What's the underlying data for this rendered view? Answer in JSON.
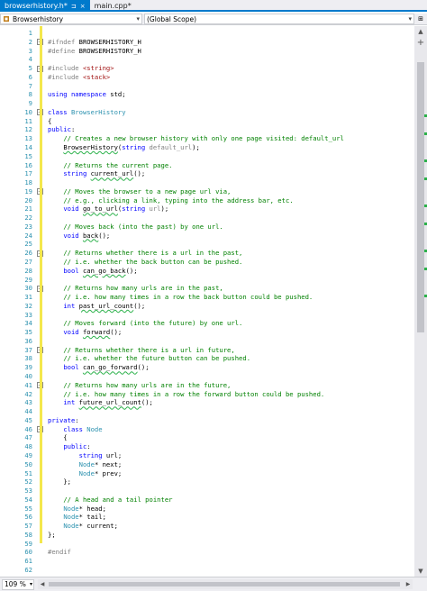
{
  "tabs": [
    {
      "label": "browserhistory.h*",
      "active": true,
      "pin": "⊐",
      "close": "×"
    },
    {
      "label": "main.cpp*",
      "active": false
    }
  ],
  "nav": {
    "scope_left": "Browserhistory",
    "scope_right": "(Global Scope)"
  },
  "status": {
    "zoom": "109 %"
  },
  "colors": {
    "accent": "#007acc",
    "change_bar": "#f4e84c",
    "line_number": "#2b91af"
  },
  "code": [
    {
      "n": "1",
      "t": [
        [
          ""
        ]
      ]
    },
    {
      "n": "2",
      "t": [
        [
          "pp",
          "#ifndef "
        ],
        [
          "",
          "BROWSERHISTORY_H"
        ]
      ],
      "fold": "−"
    },
    {
      "n": "3",
      "t": [
        [
          "pp",
          "#define "
        ],
        [
          "",
          "BROWSERHISTORY_H"
        ]
      ]
    },
    {
      "n": "4",
      "t": [
        [
          ""
        ]
      ]
    },
    {
      "n": "5",
      "t": [
        [
          "pp",
          "#include "
        ],
        [
          "str",
          "<string>"
        ]
      ],
      "fold": "−"
    },
    {
      "n": "6",
      "t": [
        [
          "pp",
          "#include "
        ],
        [
          "str",
          "<stack>"
        ]
      ]
    },
    {
      "n": "7",
      "t": [
        [
          ""
        ]
      ]
    },
    {
      "n": "8",
      "t": [
        [
          "kw",
          "using namespace "
        ],
        [
          "",
          "std;"
        ]
      ]
    },
    {
      "n": "9",
      "t": [
        [
          ""
        ]
      ]
    },
    {
      "n": "10",
      "t": [
        [
          "kw",
          "class "
        ],
        [
          "type",
          "BrowserHistory"
        ]
      ],
      "fold": "−"
    },
    {
      "n": "11",
      "t": [
        [
          "",
          "{"
        ]
      ]
    },
    {
      "n": "12",
      "t": [
        [
          "kw",
          "public"
        ],
        [
          "",
          ":"
        ]
      ]
    },
    {
      "n": "13",
      "t": [
        [
          "",
          "    "
        ],
        [
          "cmt",
          "// Creates a new browser history with only one page visited: default_url"
        ]
      ]
    },
    {
      "n": "14",
      "t": [
        [
          "",
          "    "
        ],
        [
          "fn",
          "BrowserHistory"
        ],
        [
          "",
          "("
        ],
        [
          "kw",
          "string "
        ],
        [
          "param",
          "default_url"
        ],
        [
          "",
          ");"
        ]
      ]
    },
    {
      "n": "15",
      "t": [
        [
          ""
        ]
      ]
    },
    {
      "n": "16",
      "t": [
        [
          "",
          "    "
        ],
        [
          "cmt",
          "// Returns the current page."
        ]
      ]
    },
    {
      "n": "17",
      "t": [
        [
          "",
          "    "
        ],
        [
          "kw",
          "string "
        ],
        [
          "fn",
          "current_url"
        ],
        [
          "",
          "();"
        ]
      ]
    },
    {
      "n": "18",
      "t": [
        [
          ""
        ]
      ]
    },
    {
      "n": "19",
      "t": [
        [
          "",
          "    "
        ],
        [
          "cmt",
          "// Moves the browser to a new page url via,"
        ]
      ],
      "fold": "−"
    },
    {
      "n": "20",
      "t": [
        [
          "",
          "    "
        ],
        [
          "cmt",
          "// e.g., clicking a link, typing into the address bar, etc."
        ]
      ]
    },
    {
      "n": "21",
      "t": [
        [
          "",
          "    "
        ],
        [
          "kw",
          "void "
        ],
        [
          "fn",
          "go_to_url"
        ],
        [
          "",
          "("
        ],
        [
          "kw",
          "string "
        ],
        [
          "param",
          "url"
        ],
        [
          "",
          ");"
        ]
      ]
    },
    {
      "n": "22",
      "t": [
        [
          ""
        ]
      ]
    },
    {
      "n": "23",
      "t": [
        [
          "",
          "    "
        ],
        [
          "cmt",
          "// Moves back (into the past) by one url."
        ]
      ]
    },
    {
      "n": "24",
      "t": [
        [
          "",
          "    "
        ],
        [
          "kw",
          "void "
        ],
        [
          "fn",
          "back"
        ],
        [
          "",
          "();"
        ]
      ]
    },
    {
      "n": "25",
      "t": [
        [
          ""
        ]
      ]
    },
    {
      "n": "26",
      "t": [
        [
          "",
          "    "
        ],
        [
          "cmt",
          "// Returns whether there is a url in the past,"
        ]
      ],
      "fold": "−"
    },
    {
      "n": "27",
      "t": [
        [
          "",
          "    "
        ],
        [
          "cmt",
          "// i.e. whether the back button can be pushed."
        ]
      ]
    },
    {
      "n": "28",
      "t": [
        [
          "",
          "    "
        ],
        [
          "kw",
          "bool "
        ],
        [
          "fn",
          "can_go_back"
        ],
        [
          "",
          "();"
        ]
      ]
    },
    {
      "n": "29",
      "t": [
        [
          ""
        ]
      ]
    },
    {
      "n": "30",
      "t": [
        [
          "",
          "    "
        ],
        [
          "cmt",
          "// Returns how many urls are in the past,"
        ]
      ],
      "fold": "−"
    },
    {
      "n": "31",
      "t": [
        [
          "",
          "    "
        ],
        [
          "cmt",
          "// i.e. how many times in a row the back button could be pushed."
        ]
      ]
    },
    {
      "n": "32",
      "t": [
        [
          "",
          "    "
        ],
        [
          "kw",
          "int "
        ],
        [
          "fn",
          "past_url_count"
        ],
        [
          "",
          "();"
        ]
      ]
    },
    {
      "n": "33",
      "t": [
        [
          ""
        ]
      ]
    },
    {
      "n": "34",
      "t": [
        [
          "",
          "    "
        ],
        [
          "cmt",
          "// Moves forward (into the future) by one url."
        ]
      ]
    },
    {
      "n": "35",
      "t": [
        [
          "",
          "    "
        ],
        [
          "kw",
          "void "
        ],
        [
          "fn",
          "forward"
        ],
        [
          "",
          "();"
        ]
      ]
    },
    {
      "n": "36",
      "t": [
        [
          ""
        ]
      ]
    },
    {
      "n": "37",
      "t": [
        [
          "",
          "    "
        ],
        [
          "cmt",
          "// Returns whether there is a url in future,"
        ]
      ],
      "fold": "−"
    },
    {
      "n": "38",
      "t": [
        [
          "",
          "    "
        ],
        [
          "cmt",
          "// i.e. whether the future button can be pushed."
        ]
      ]
    },
    {
      "n": "39",
      "t": [
        [
          "",
          "    "
        ],
        [
          "kw",
          "bool "
        ],
        [
          "fn",
          "can_go_forward"
        ],
        [
          "",
          "();"
        ]
      ]
    },
    {
      "n": "40",
      "t": [
        [
          ""
        ]
      ]
    },
    {
      "n": "41",
      "t": [
        [
          "",
          "    "
        ],
        [
          "cmt",
          "// Returns how many urls are in the future,"
        ]
      ],
      "fold": "−"
    },
    {
      "n": "42",
      "t": [
        [
          "",
          "    "
        ],
        [
          "cmt",
          "// i.e. how many times in a row the forward button could be pushed."
        ]
      ]
    },
    {
      "n": "43",
      "t": [
        [
          "",
          "    "
        ],
        [
          "kw",
          "int "
        ],
        [
          "fn",
          "future_url_count"
        ],
        [
          "",
          "();"
        ]
      ]
    },
    {
      "n": "44",
      "t": [
        [
          ""
        ]
      ]
    },
    {
      "n": "45",
      "t": [
        [
          "kw",
          "private"
        ],
        [
          "",
          ":"
        ]
      ]
    },
    {
      "n": "46",
      "t": [
        [
          "",
          "    "
        ],
        [
          "kw",
          "class "
        ],
        [
          "type",
          "Node"
        ]
      ],
      "fold": "−"
    },
    {
      "n": "47",
      "t": [
        [
          "",
          "    {"
        ]
      ]
    },
    {
      "n": "48",
      "t": [
        [
          "",
          "    "
        ],
        [
          "kw",
          "public"
        ],
        [
          "",
          ":"
        ]
      ]
    },
    {
      "n": "49",
      "t": [
        [
          "",
          "        "
        ],
        [
          "kw",
          "string "
        ],
        [
          "",
          "url;"
        ]
      ]
    },
    {
      "n": "50",
      "t": [
        [
          "",
          "        "
        ],
        [
          "type",
          "Node"
        ],
        [
          "",
          "* next;"
        ]
      ]
    },
    {
      "n": "51",
      "t": [
        [
          "",
          "        "
        ],
        [
          "type",
          "Node"
        ],
        [
          "",
          "* prev;"
        ]
      ]
    },
    {
      "n": "52",
      "t": [
        [
          "",
          "    };"
        ]
      ]
    },
    {
      "n": "53",
      "t": [
        [
          ""
        ]
      ]
    },
    {
      "n": "54",
      "t": [
        [
          "",
          "    "
        ],
        [
          "cmt",
          "// A head and a tail pointer"
        ]
      ]
    },
    {
      "n": "55",
      "t": [
        [
          "",
          "    "
        ],
        [
          "type",
          "Node"
        ],
        [
          "",
          "* head;"
        ]
      ]
    },
    {
      "n": "56",
      "t": [
        [
          "",
          "    "
        ],
        [
          "type",
          "Node"
        ],
        [
          "",
          "* tail;"
        ]
      ]
    },
    {
      "n": "57",
      "t": [
        [
          "",
          "    "
        ],
        [
          "type",
          "Node"
        ],
        [
          "",
          "* current;"
        ]
      ]
    },
    {
      "n": "58",
      "t": [
        [
          "",
          "};"
        ]
      ]
    },
    {
      "n": "59",
      "t": [
        [
          ""
        ]
      ]
    },
    {
      "n": "60",
      "t": [
        [
          "pp",
          "#endif"
        ]
      ]
    },
    {
      "n": "61",
      "t": [
        [
          ""
        ]
      ]
    },
    {
      "n": "62",
      "t": [
        [
          ""
        ]
      ]
    }
  ]
}
